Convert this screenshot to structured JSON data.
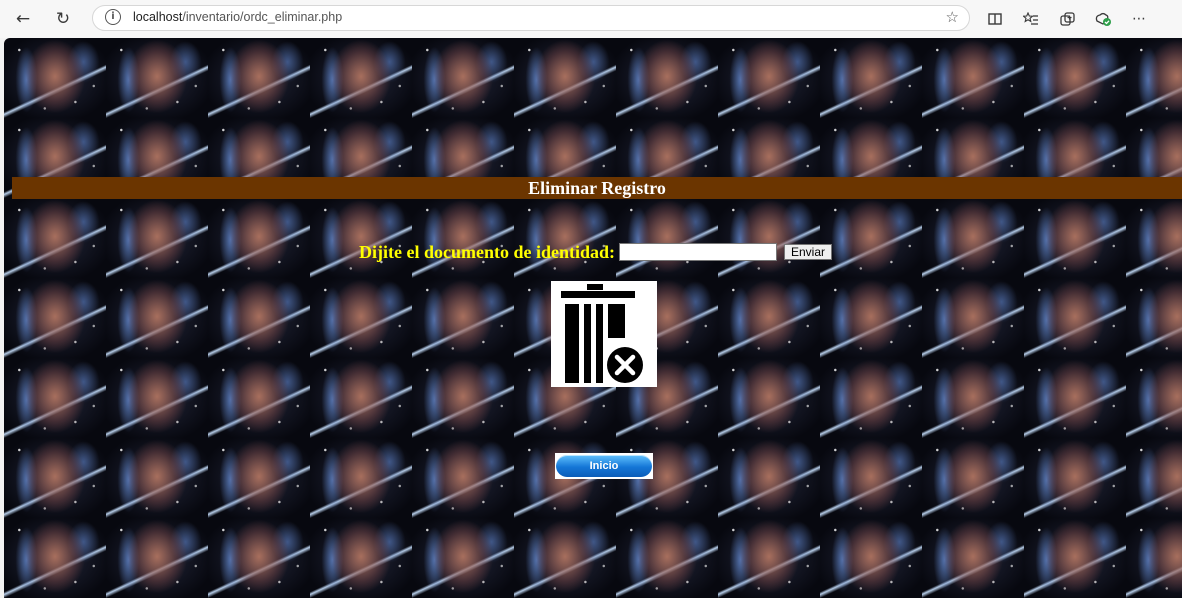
{
  "browser": {
    "url_host": "localhost",
    "url_path": "/inventario/ordc_eliminar.php",
    "icons": [
      "back-arrow-icon",
      "refresh-icon",
      "info-icon",
      "favorite-star-icon",
      "split-screen-icon",
      "favorites-icon",
      "collections-icon",
      "extensions-icon",
      "more-icon"
    ]
  },
  "page": {
    "title": "Eliminar Registro",
    "form": {
      "label": "Dijite el documento de identidad:",
      "input_value": "",
      "submit_label": "Enviar"
    },
    "delete_icon": "trash-delete-icon",
    "home_button_label": "Inicio"
  },
  "colors": {
    "title_bar": "#6b3500",
    "label": "#ffff00",
    "home_button": "#1476d6"
  }
}
